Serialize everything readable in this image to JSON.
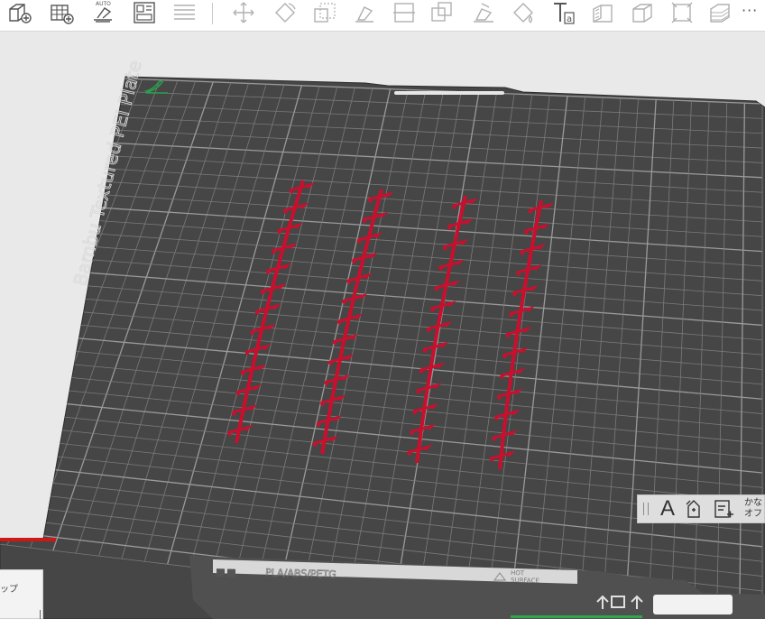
{
  "toolbar": {
    "buttons": [
      {
        "name": "add-object-icon"
      },
      {
        "name": "add-plate-icon"
      },
      {
        "name": "auto-orient-icon",
        "badge": "AUTO"
      },
      {
        "name": "arrange-icon"
      },
      {
        "name": "layers-icon"
      },
      {
        "name": "move-icon"
      },
      {
        "name": "rotate-icon"
      },
      {
        "name": "scale-icon"
      },
      {
        "name": "lay-on-face-icon"
      },
      {
        "name": "cut-icon"
      },
      {
        "name": "boolean-icon"
      },
      {
        "name": "support-paint-icon"
      },
      {
        "name": "color-paint-icon"
      },
      {
        "name": "text-tool-icon",
        "badge": "a"
      },
      {
        "name": "seam-paint-icon"
      },
      {
        "name": "assembly-icon"
      },
      {
        "name": "measure-icon"
      },
      {
        "name": "variable-layer-icon"
      }
    ],
    "more_label": "···"
  },
  "plate": {
    "name_label": "Bambu Textured PEI Plate",
    "material_label": "PLA/ABS/PETG",
    "surface_label_line1": "HOT",
    "surface_label_line2": "SURFACE"
  },
  "right_panel": {
    "text_tool_label": "A",
    "ime_line1": "かな",
    "ime_line2": "オフ"
  },
  "bottom_left_panel": {
    "label": "ップ"
  },
  "colors": {
    "plate": "#464646",
    "grid": "#7a7a7a",
    "model": "#c8102e",
    "toolbar_icon": "#555555",
    "toolbar_icon_disabled": "#b0b0b0"
  }
}
